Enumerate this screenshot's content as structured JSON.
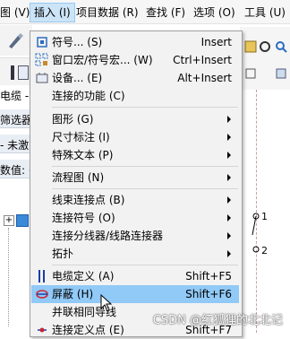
{
  "menubar": {
    "items": [
      {
        "label": "图 (V)"
      },
      {
        "label": "插入 (I)",
        "active": true
      },
      {
        "label": "项目数据 (R)"
      },
      {
        "label": "查找 (F)"
      },
      {
        "label": "选项 (O)"
      },
      {
        "label": "工具 (U)"
      }
    ]
  },
  "background": {
    "panel_title": "电缆 - 示",
    "filter_label": "筛选器",
    "filter_value": "- 未激",
    "value_label": "数值: (V",
    "tree_node": "+",
    "canvas_marks": [
      "1",
      "2"
    ]
  },
  "menu": {
    "items": [
      {
        "label": "符号... (S)",
        "shortcut": "Insert",
        "icon": "symbol-icon"
      },
      {
        "label": "窗口宏/符号宏... (W)",
        "shortcut": "Ctrl+Insert",
        "icon": "window-macro-icon"
      },
      {
        "label": "设备... (E)",
        "shortcut": "Alt+Insert",
        "icon": "device-icon"
      },
      {
        "label": "连接的功能 (C)",
        "shortcut": ""
      },
      {
        "label": "图形 (G)",
        "submenu": true
      },
      {
        "label": "尺寸标注 (I)",
        "submenu": true
      },
      {
        "label": "特殊文本 (P)",
        "submenu": true
      },
      {
        "label": "流程图 (N)",
        "submenu": true
      },
      {
        "label": "线束连接点 (B)",
        "submenu": true
      },
      {
        "label": "连接符号 (O)",
        "submenu": true
      },
      {
        "label": "连接分线器/线路连接器",
        "submenu": true
      },
      {
        "label": "拓扑",
        "submenu": true
      },
      {
        "label": "电缆定义 (A)",
        "shortcut": "Shift+F5",
        "icon": "cable-definition-icon"
      },
      {
        "label": "屏蔽 (H)",
        "shortcut": "Shift+F6",
        "icon": "shield-icon",
        "highlighted": true
      },
      {
        "label": "并联相同导线",
        "shortcut": ""
      },
      {
        "label": "连接定义点 (E)",
        "shortcut": "Shift+F7",
        "icon": "connection-definition-icon"
      }
    ]
  },
  "watermark": "CSDN @红狐狸的北北记"
}
